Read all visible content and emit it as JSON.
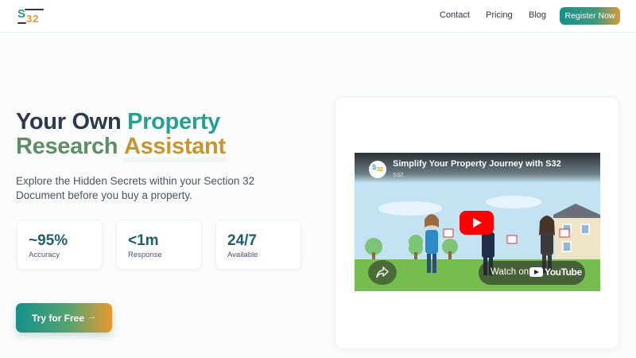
{
  "brand": {
    "logo_letter": "S",
    "logo_number": "32",
    "primary_color": "#1f9d93",
    "accent_color": "#e8992c"
  },
  "nav": {
    "items": [
      {
        "label": "Contact"
      },
      {
        "label": "Pricing"
      },
      {
        "label": "Blog"
      }
    ],
    "register_label": "Register Now"
  },
  "hero": {
    "title_part1": "Your Own",
    "title_part2": "Property",
    "title_part3": "Research",
    "title_part4": "Assistant",
    "subtitle": "Explore the Hidden Secrets within your Section 32 Document before you buy a property."
  },
  "stats": [
    {
      "value": "~95%",
      "label": "Accuracy"
    },
    {
      "value": "<1m",
      "label": "Response"
    },
    {
      "value": "24/7",
      "label": "Available"
    }
  ],
  "cta": {
    "label": "Try for Free",
    "icon": "arrow-right-icon"
  },
  "video": {
    "title": "Simplify Your Property Journey with S32",
    "channel": "S32",
    "avatar_letter": "S",
    "avatar_number": "32",
    "watch_on": "Watch on",
    "platform": "YouTube",
    "icons": [
      "play-icon",
      "share-icon",
      "youtube-icon"
    ]
  }
}
